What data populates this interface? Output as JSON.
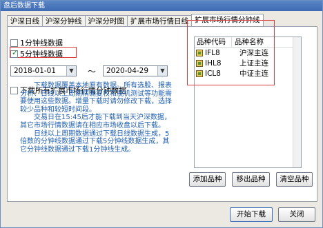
{
  "window": {
    "title": "盘后数据下载"
  },
  "tabs": [
    {
      "label": "沪深日线"
    },
    {
      "label": "沪深分钟线"
    },
    {
      "label": "沪深分时图"
    },
    {
      "label": "扩展市场行情日线"
    },
    {
      "label": "扩展市场行情分钟线"
    }
  ],
  "options": {
    "one_min": {
      "label": "1分钟线数据",
      "checked": false
    },
    "five_min": {
      "label": "5分钟线数据",
      "checked": true
    },
    "download_all": {
      "label": "下载所有扩展市场行情分钟数据",
      "checked": false
    }
  },
  "date_range": {
    "start": "2018-01-01",
    "separator": "～",
    "end": "2020-04-29"
  },
  "note": {
    "paragraphs": [
      "下载数据覆盖本地原有数据。所有选股、报表分析、日线以上周期精确复权和脱机测试等功能需要使用这些数据。增量下载时请勿修改下载，选择较少品种和较短时间段。",
      "交易日在15:45后才能下载到当天沪深数据，其它市场行情数据请在相应市场收盘以后下载。",
      "日线以上周期数据通过下载日线数据生成，5倍数的分钟线数据通过下载5分钟线数据生成，其它分钟线数据通过下载1分钟线生成。"
    ]
  },
  "list": {
    "headers": {
      "code": "品种代码",
      "name": "品种名称"
    },
    "rows": [
      {
        "code": "IFL8",
        "name": "沪深主连",
        "icon": "contract-icon"
      },
      {
        "code": "IHL8",
        "name": "上证主连",
        "icon": "contract-icon"
      },
      {
        "code": "ICL8",
        "name": "中证主连",
        "icon": "contract-icon"
      }
    ]
  },
  "buttons": {
    "add": "添加品种",
    "remove": "移出品种",
    "clear": "清空品种",
    "start": "开始下载",
    "close": "关闭"
  },
  "colors": {
    "highlight_box": "#e03b3b",
    "note_text": "#1f5fb0",
    "check": "#0b8a2a"
  }
}
